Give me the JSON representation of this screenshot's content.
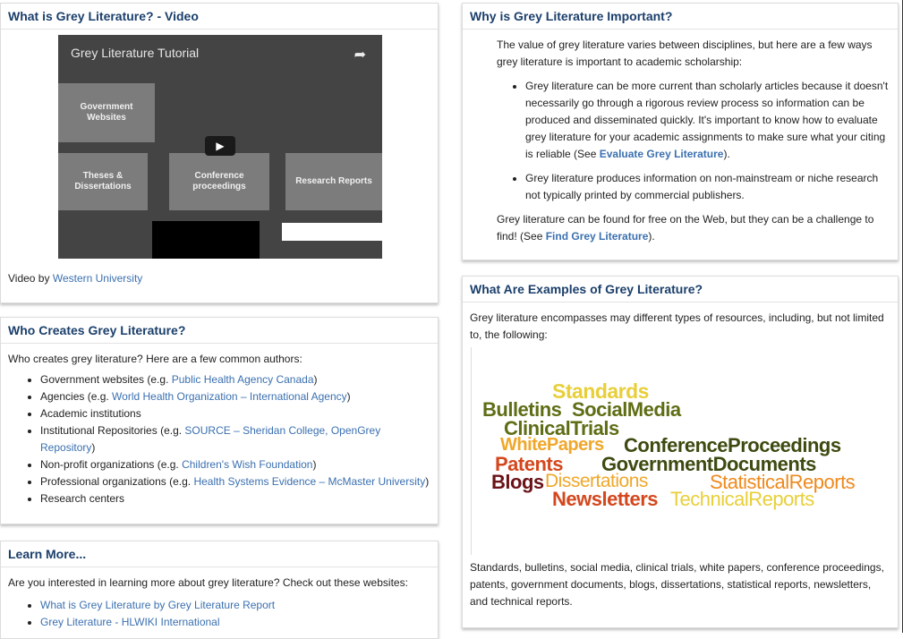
{
  "video_box": {
    "title": "What is Grey Literature? - Video",
    "video_title": "Grey Literature Tutorial",
    "tiles": [
      "Government\nWebsites",
      "Theses &\nDissertations",
      "Conference\nproceedings",
      "Research Reports"
    ],
    "credit_prefix": "Video by ",
    "credit_link": "Western University"
  },
  "creators_box": {
    "title": "Who Creates Grey Literature?",
    "intro": "Who creates grey literature? Here are a few common authors:",
    "items": [
      {
        "text": "Government websites (e.g. ",
        "link": "Public Health Agency Canada",
        "after": ")"
      },
      {
        "text": "Agencies (e.g. ",
        "link": "World Health Organization – International Agency",
        "after": ")"
      },
      {
        "text": "Academic institutions",
        "link": "",
        "after": ""
      },
      {
        "text": "Institutional Repositories (e.g. ",
        "link": "SOURCE – Sheridan College, OpenGrey Repository",
        "after": ")"
      },
      {
        "text": "Non-profit organizations (e.g. ",
        "link": "Children's Wish Foundation",
        "after": ")"
      },
      {
        "text": "Professional organizations (e.g. ",
        "link": "Health Systems Evidence – McMaster University",
        "after": ")"
      },
      {
        "text": "Research centers",
        "link": "",
        "after": ""
      }
    ]
  },
  "learn_box": {
    "title": "Learn More...",
    "intro": "Are you interested in learning more about grey literature? Check out these websites:",
    "links": [
      "What is Grey Literature by Grey Literature Report",
      "Grey Literature - HLWIKI International"
    ]
  },
  "important_box": {
    "title": "Why is Grey Literature Important?",
    "intro": "The value of grey literature varies between disciplines, but here are a few ways grey literature is important to academic scholarship:",
    "bullet1_text": "Grey literature can be more current than scholarly articles because it doesn't necessarily go through a rigorous review process so information can be produced and disseminated quickly. It's important to know how to evaluate grey literature for your academic assignments to make sure what your citing is reliable (See ",
    "bullet1_link": "Evaluate Grey Literature",
    "bullet1_after": ").",
    "bullet2_text": "Grey literature produces information on non-mainstream or niche research not typically printed by commercial publishers.",
    "outro_text": "Grey literature can be found for free on the Web, but they can be a challenge to find! (See ",
    "outro_link": "Find Grey Literature",
    "outro_after": ")."
  },
  "examples_box": {
    "title": "What Are Examples of Grey Literature?",
    "intro": "Grey literature encompasses may different types of resources, including, but not limited to, the following:",
    "cloud_words": [
      {
        "text": "Standards",
        "color": "#e8cf3a"
      },
      {
        "text": "Bulletins",
        "color": "#5f6d15"
      },
      {
        "text": "SocialMedia",
        "color": "#5f6d15"
      },
      {
        "text": "ClinicalTrials",
        "color": "#5f6d15"
      },
      {
        "text": "WhitePapers",
        "color": "#f0a72a"
      },
      {
        "text": "ConferenceProceedings",
        "color": "#3d4a10"
      },
      {
        "text": "Patents",
        "color": "#d4471d"
      },
      {
        "text": "GovernmentDocuments",
        "color": "#3d4a10"
      },
      {
        "text": "Blogs",
        "color": "#6a1218"
      },
      {
        "text": "Dissertations",
        "color": "#f0a72a"
      },
      {
        "text": "StatisticalReports",
        "color": "#ee8a1e"
      },
      {
        "text": "Newsletters",
        "color": "#d4471d"
      },
      {
        "text": "TechnicalReports",
        "color": "#e8cf3a"
      }
    ],
    "caption": "Standards, bulletins, social media, clinical trials, white papers, conference proceedings, patents, government documents, blogs, dissertations, statistical reports, newsletters, and technical reports."
  }
}
